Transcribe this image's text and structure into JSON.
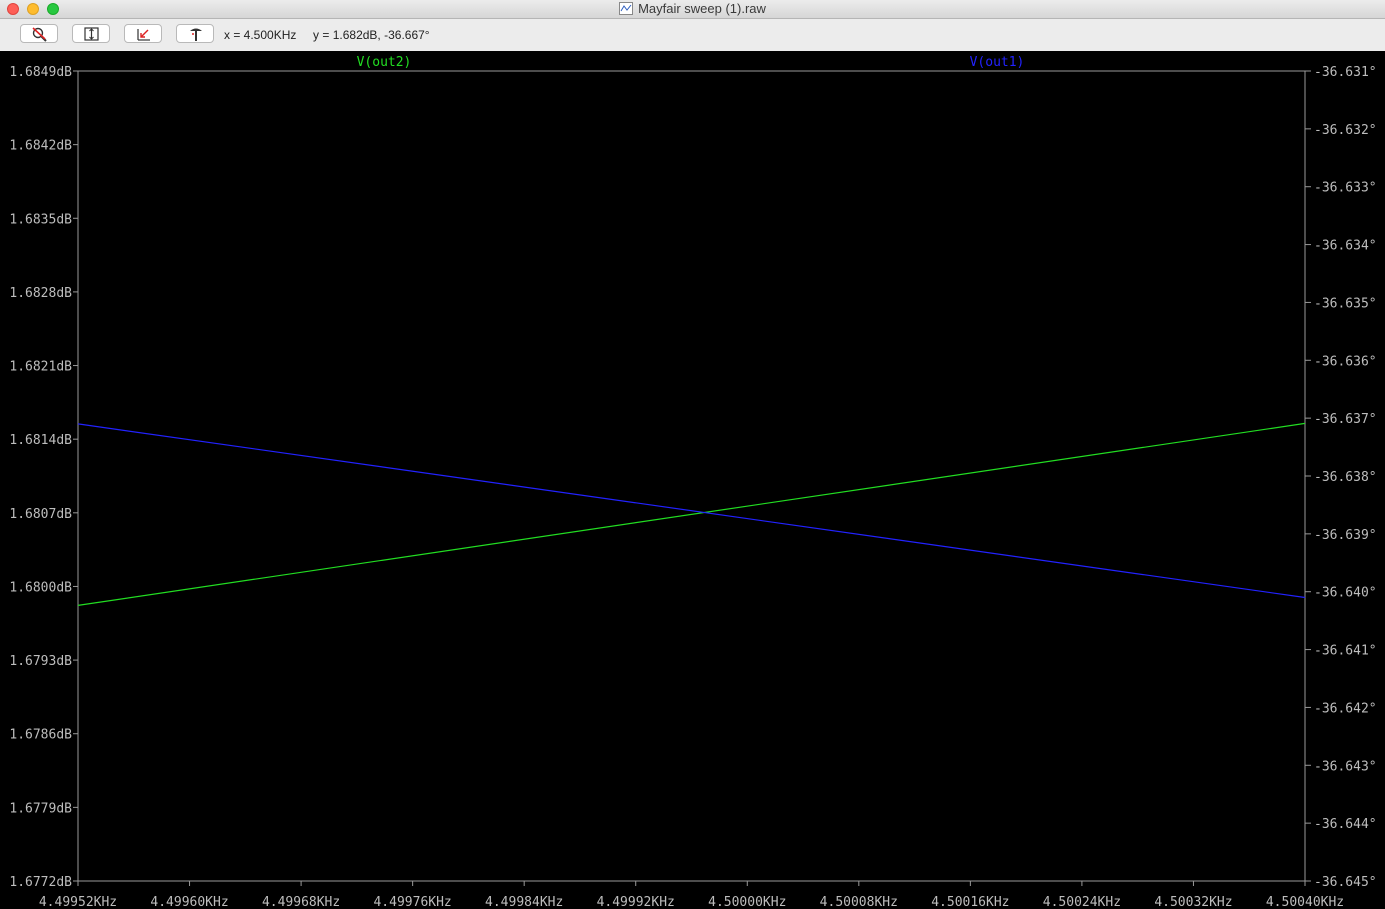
{
  "window": {
    "title": "Mayfair sweep (1).raw"
  },
  "toolbar": {
    "buttons": [
      {
        "name": "zoom-cancel-button",
        "icon": "magnifier-cancel-icon"
      },
      {
        "name": "autorange-button",
        "icon": "fit-range-icon"
      },
      {
        "name": "zoom-back-button",
        "icon": "zoom-back-icon"
      },
      {
        "name": "pick-trace-button",
        "icon": "probe-icon"
      }
    ],
    "cursor_x": "x = 4.500KHz",
    "cursor_y": "y = 1.682dB, -36.667°"
  },
  "colors": {
    "background": "#000000",
    "axes": "#9a9a9a",
    "ticks_text": "#bdbdbd",
    "trace_out2": "#22dd22",
    "trace_out1": "#2222ff"
  },
  "chart_data": {
    "type": "line",
    "x_ticks": [
      "4.49952KHz",
      "4.49960KHz",
      "4.49968KHz",
      "4.49976KHz",
      "4.49984KHz",
      "4.49992KHz",
      "4.50000KHz",
      "4.50008KHz",
      "4.50016KHz",
      "4.50024KHz",
      "4.50032KHz",
      "4.50040KHz"
    ],
    "y_left_ticks": [
      "1.6849dB",
      "1.6842dB",
      "1.6835dB",
      "1.6828dB",
      "1.6821dB",
      "1.6814dB",
      "1.6807dB",
      "1.6800dB",
      "1.6793dB",
      "1.6786dB",
      "1.6779dB",
      "1.6772dB"
    ],
    "y_right_ticks": [
      "-36.631°",
      "-36.632°",
      "-36.633°",
      "-36.634°",
      "-36.635°",
      "-36.636°",
      "-36.637°",
      "-36.638°",
      "-36.639°",
      "-36.640°",
      "-36.641°",
      "-36.642°",
      "-36.643°",
      "-36.644°",
      "-36.645°"
    ],
    "xlim": [
      4.49952,
      4.5004
    ],
    "ylim_left": [
      1.6772,
      1.6849
    ],
    "ylim_right": [
      -36.645,
      -36.631
    ],
    "grid": false,
    "series": [
      {
        "name": "V(out2)",
        "axis": "left",
        "color": "#22dd22",
        "x": [
          4.49952,
          4.5004
        ],
        "y": [
          1.67982,
          1.68155
        ]
      },
      {
        "name": "V(out1)",
        "axis": "right",
        "color": "#2222ff",
        "x": [
          4.49952,
          4.5004
        ],
        "y": [
          -36.6371,
          -36.6401
        ]
      }
    ]
  }
}
